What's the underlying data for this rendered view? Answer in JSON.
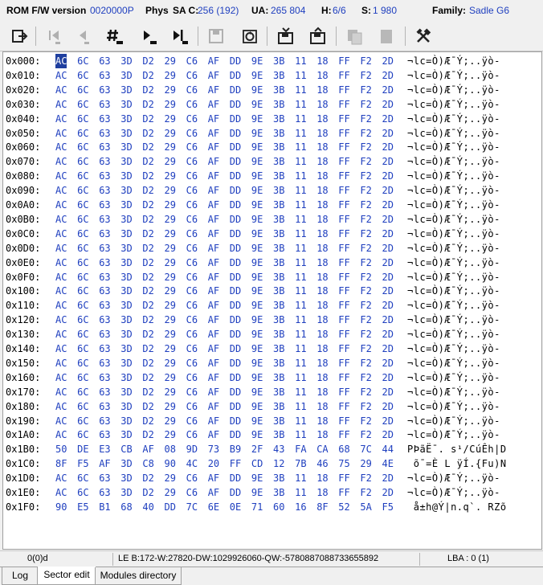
{
  "info": {
    "rom_label": "ROM F/W version",
    "rom_value": "0020000P",
    "phys_label": "Phys",
    "sac_label": "SA C:",
    "sac_value": "256 (192)",
    "ua_label": "UA:",
    "ua_value": "265 804",
    "h_label": "H:",
    "h_value": "6/6",
    "s_label": "S:",
    "s_value": "1 980",
    "family_label": "Family:",
    "family_value": "Sadle G6"
  },
  "toolbar_icons": [
    "exit-icon",
    "first-icon",
    "prev-icon",
    "goto-icon",
    "next-icon",
    "last-icon",
    "save-icon",
    "refresh-icon",
    "load-file-icon",
    "save-file-icon",
    "copy-icon",
    "paste-icon",
    "tools-icon"
  ],
  "hex": {
    "rows": [
      {
        "addr": "0x000:",
        "bytes": [
          "AC",
          "6C",
          "63",
          "3D",
          "D2",
          "29",
          "C6",
          "AF",
          "DD",
          "9E",
          "3B",
          "11",
          "18",
          "FF",
          "F2",
          "2D"
        ],
        "ascii": "¬lc=Ò)Æ¯Ý;..ÿò-"
      },
      {
        "addr": "0x010:",
        "bytes": [
          "AC",
          "6C",
          "63",
          "3D",
          "D2",
          "29",
          "C6",
          "AF",
          "DD",
          "9E",
          "3B",
          "11",
          "18",
          "FF",
          "F2",
          "2D"
        ],
        "ascii": "¬lc=Ò)Æ¯Ý;..ÿò-"
      },
      {
        "addr": "0x020:",
        "bytes": [
          "AC",
          "6C",
          "63",
          "3D",
          "D2",
          "29",
          "C6",
          "AF",
          "DD",
          "9E",
          "3B",
          "11",
          "18",
          "FF",
          "F2",
          "2D"
        ],
        "ascii": "¬lc=Ò)Æ¯Ý;..ÿò-"
      },
      {
        "addr": "0x030:",
        "bytes": [
          "AC",
          "6C",
          "63",
          "3D",
          "D2",
          "29",
          "C6",
          "AF",
          "DD",
          "9E",
          "3B",
          "11",
          "18",
          "FF",
          "F2",
          "2D"
        ],
        "ascii": "¬lc=Ò)Æ¯Ý;..ÿò-"
      },
      {
        "addr": "0x040:",
        "bytes": [
          "AC",
          "6C",
          "63",
          "3D",
          "D2",
          "29",
          "C6",
          "AF",
          "DD",
          "9E",
          "3B",
          "11",
          "18",
          "FF",
          "F2",
          "2D"
        ],
        "ascii": "¬lc=Ò)Æ¯Ý;..ÿò-"
      },
      {
        "addr": "0x050:",
        "bytes": [
          "AC",
          "6C",
          "63",
          "3D",
          "D2",
          "29",
          "C6",
          "AF",
          "DD",
          "9E",
          "3B",
          "11",
          "18",
          "FF",
          "F2",
          "2D"
        ],
        "ascii": "¬lc=Ò)Æ¯Ý;..ÿò-"
      },
      {
        "addr": "0x060:",
        "bytes": [
          "AC",
          "6C",
          "63",
          "3D",
          "D2",
          "29",
          "C6",
          "AF",
          "DD",
          "9E",
          "3B",
          "11",
          "18",
          "FF",
          "F2",
          "2D"
        ],
        "ascii": "¬lc=Ò)Æ¯Ý;..ÿò-"
      },
      {
        "addr": "0x070:",
        "bytes": [
          "AC",
          "6C",
          "63",
          "3D",
          "D2",
          "29",
          "C6",
          "AF",
          "DD",
          "9E",
          "3B",
          "11",
          "18",
          "FF",
          "F2",
          "2D"
        ],
        "ascii": "¬lc=Ò)Æ¯Ý;..ÿò-"
      },
      {
        "addr": "0x080:",
        "bytes": [
          "AC",
          "6C",
          "63",
          "3D",
          "D2",
          "29",
          "C6",
          "AF",
          "DD",
          "9E",
          "3B",
          "11",
          "18",
          "FF",
          "F2",
          "2D"
        ],
        "ascii": "¬lc=Ò)Æ¯Ý;..ÿò-"
      },
      {
        "addr": "0x090:",
        "bytes": [
          "AC",
          "6C",
          "63",
          "3D",
          "D2",
          "29",
          "C6",
          "AF",
          "DD",
          "9E",
          "3B",
          "11",
          "18",
          "FF",
          "F2",
          "2D"
        ],
        "ascii": "¬lc=Ò)Æ¯Ý;..ÿò-"
      },
      {
        "addr": "0x0A0:",
        "bytes": [
          "AC",
          "6C",
          "63",
          "3D",
          "D2",
          "29",
          "C6",
          "AF",
          "DD",
          "9E",
          "3B",
          "11",
          "18",
          "FF",
          "F2",
          "2D"
        ],
        "ascii": "¬lc=Ò)Æ¯Ý;..ÿò-"
      },
      {
        "addr": "0x0B0:",
        "bytes": [
          "AC",
          "6C",
          "63",
          "3D",
          "D2",
          "29",
          "C6",
          "AF",
          "DD",
          "9E",
          "3B",
          "11",
          "18",
          "FF",
          "F2",
          "2D"
        ],
        "ascii": "¬lc=Ò)Æ¯Ý;..ÿò-"
      },
      {
        "addr": "0x0C0:",
        "bytes": [
          "AC",
          "6C",
          "63",
          "3D",
          "D2",
          "29",
          "C6",
          "AF",
          "DD",
          "9E",
          "3B",
          "11",
          "18",
          "FF",
          "F2",
          "2D"
        ],
        "ascii": "¬lc=Ò)Æ¯Ý;..ÿò-"
      },
      {
        "addr": "0x0D0:",
        "bytes": [
          "AC",
          "6C",
          "63",
          "3D",
          "D2",
          "29",
          "C6",
          "AF",
          "DD",
          "9E",
          "3B",
          "11",
          "18",
          "FF",
          "F2",
          "2D"
        ],
        "ascii": "¬lc=Ò)Æ¯Ý;..ÿò-"
      },
      {
        "addr": "0x0E0:",
        "bytes": [
          "AC",
          "6C",
          "63",
          "3D",
          "D2",
          "29",
          "C6",
          "AF",
          "DD",
          "9E",
          "3B",
          "11",
          "18",
          "FF",
          "F2",
          "2D"
        ],
        "ascii": "¬lc=Ò)Æ¯Ý;..ÿò-"
      },
      {
        "addr": "0x0F0:",
        "bytes": [
          "AC",
          "6C",
          "63",
          "3D",
          "D2",
          "29",
          "C6",
          "AF",
          "DD",
          "9E",
          "3B",
          "11",
          "18",
          "FF",
          "F2",
          "2D"
        ],
        "ascii": "¬lc=Ò)Æ¯Ý;..ÿò-"
      },
      {
        "addr": "0x100:",
        "bytes": [
          "AC",
          "6C",
          "63",
          "3D",
          "D2",
          "29",
          "C6",
          "AF",
          "DD",
          "9E",
          "3B",
          "11",
          "18",
          "FF",
          "F2",
          "2D"
        ],
        "ascii": "¬lc=Ò)Æ¯Ý;..ÿò-"
      },
      {
        "addr": "0x110:",
        "bytes": [
          "AC",
          "6C",
          "63",
          "3D",
          "D2",
          "29",
          "C6",
          "AF",
          "DD",
          "9E",
          "3B",
          "11",
          "18",
          "FF",
          "F2",
          "2D"
        ],
        "ascii": "¬lc=Ò)Æ¯Ý;..ÿò-"
      },
      {
        "addr": "0x120:",
        "bytes": [
          "AC",
          "6C",
          "63",
          "3D",
          "D2",
          "29",
          "C6",
          "AF",
          "DD",
          "9E",
          "3B",
          "11",
          "18",
          "FF",
          "F2",
          "2D"
        ],
        "ascii": "¬lc=Ò)Æ¯Ý;..ÿò-"
      },
      {
        "addr": "0x130:",
        "bytes": [
          "AC",
          "6C",
          "63",
          "3D",
          "D2",
          "29",
          "C6",
          "AF",
          "DD",
          "9E",
          "3B",
          "11",
          "18",
          "FF",
          "F2",
          "2D"
        ],
        "ascii": "¬lc=Ò)Æ¯Ý;..ÿò-"
      },
      {
        "addr": "0x140:",
        "bytes": [
          "AC",
          "6C",
          "63",
          "3D",
          "D2",
          "29",
          "C6",
          "AF",
          "DD",
          "9E",
          "3B",
          "11",
          "18",
          "FF",
          "F2",
          "2D"
        ],
        "ascii": "¬lc=Ò)Æ¯Ý;..ÿò-"
      },
      {
        "addr": "0x150:",
        "bytes": [
          "AC",
          "6C",
          "63",
          "3D",
          "D2",
          "29",
          "C6",
          "AF",
          "DD",
          "9E",
          "3B",
          "11",
          "18",
          "FF",
          "F2",
          "2D"
        ],
        "ascii": "¬lc=Ò)Æ¯Ý;..ÿò-"
      },
      {
        "addr": "0x160:",
        "bytes": [
          "AC",
          "6C",
          "63",
          "3D",
          "D2",
          "29",
          "C6",
          "AF",
          "DD",
          "9E",
          "3B",
          "11",
          "18",
          "FF",
          "F2",
          "2D"
        ],
        "ascii": "¬lc=Ò)Æ¯Ý;..ÿò-"
      },
      {
        "addr": "0x170:",
        "bytes": [
          "AC",
          "6C",
          "63",
          "3D",
          "D2",
          "29",
          "C6",
          "AF",
          "DD",
          "9E",
          "3B",
          "11",
          "18",
          "FF",
          "F2",
          "2D"
        ],
        "ascii": "¬lc=Ò)Æ¯Ý;..ÿò-"
      },
      {
        "addr": "0x180:",
        "bytes": [
          "AC",
          "6C",
          "63",
          "3D",
          "D2",
          "29",
          "C6",
          "AF",
          "DD",
          "9E",
          "3B",
          "11",
          "18",
          "FF",
          "F2",
          "2D"
        ],
        "ascii": "¬lc=Ò)Æ¯Ý;..ÿò-"
      },
      {
        "addr": "0x190:",
        "bytes": [
          "AC",
          "6C",
          "63",
          "3D",
          "D2",
          "29",
          "C6",
          "AF",
          "DD",
          "9E",
          "3B",
          "11",
          "18",
          "FF",
          "F2",
          "2D"
        ],
        "ascii": "¬lc=Ò)Æ¯Ý;..ÿò-"
      },
      {
        "addr": "0x1A0:",
        "bytes": [
          "AC",
          "6C",
          "63",
          "3D",
          "D2",
          "29",
          "C6",
          "AF",
          "DD",
          "9E",
          "3B",
          "11",
          "18",
          "FF",
          "F2",
          "2D"
        ],
        "ascii": "¬lc=Ò)Æ¯Ý;..ÿò-"
      },
      {
        "addr": "0x1B0:",
        "bytes": [
          "50",
          "DE",
          "E3",
          "CB",
          "AF",
          "08",
          "9D",
          "73",
          "B9",
          "2F",
          "43",
          "FA",
          "CA",
          "68",
          "7C",
          "44"
        ],
        "ascii": "PÞãË¯. s¹/CúÊh|D"
      },
      {
        "addr": "0x1C0:",
        "bytes": [
          "8F",
          "F5",
          "AF",
          "3D",
          "C8",
          "90",
          "4C",
          "20",
          "FF",
          "CD",
          "12",
          "7B",
          "46",
          "75",
          "29",
          "4E"
        ],
        "ascii": " õ¯=È L ÿÍ.{Fu)N"
      },
      {
        "addr": "0x1D0:",
        "bytes": [
          "AC",
          "6C",
          "63",
          "3D",
          "D2",
          "29",
          "C6",
          "AF",
          "DD",
          "9E",
          "3B",
          "11",
          "18",
          "FF",
          "F2",
          "2D"
        ],
        "ascii": "¬lc=Ò)Æ¯Ý;..ÿò-"
      },
      {
        "addr": "0x1E0:",
        "bytes": [
          "AC",
          "6C",
          "63",
          "3D",
          "D2",
          "29",
          "C6",
          "AF",
          "DD",
          "9E",
          "3B",
          "11",
          "18",
          "FF",
          "F2",
          "2D"
        ],
        "ascii": "¬lc=Ò)Æ¯Ý;..ÿò-"
      },
      {
        "addr": "0x1F0:",
        "bytes": [
          "90",
          "E5",
          "B1",
          "68",
          "40",
          "DD",
          "7C",
          "6E",
          "0E",
          "71",
          "60",
          "16",
          "8F",
          "52",
          "5A",
          "F5"
        ],
        "ascii": " å±h@Ý|n.q`. RZõ"
      }
    ]
  },
  "status": {
    "position": "0(0)d",
    "values": "LE B:172-W:27820-DW:1029926060-QW:-5780887088733655892",
    "lba": "LBA : 0 (1)"
  },
  "tabs": [
    {
      "label": "Log"
    },
    {
      "label": "Sector edit"
    },
    {
      "label": "Modules directory"
    }
  ],
  "colors": {
    "hex_byte": "#1f3fbf",
    "selection": "#1f3f9f",
    "info_value": "#1f3fbf"
  }
}
